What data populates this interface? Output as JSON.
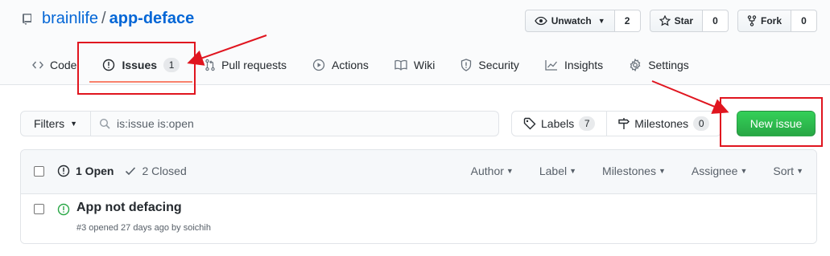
{
  "repo": {
    "owner": "brainlife",
    "separator": "/",
    "name": "app-deface"
  },
  "actions": {
    "watch": {
      "label": "Unwatch",
      "count": "2"
    },
    "star": {
      "label": "Star",
      "count": "0"
    },
    "fork": {
      "label": "Fork",
      "count": "0"
    }
  },
  "tabs": [
    {
      "label": "Code"
    },
    {
      "label": "Issues",
      "count": "1"
    },
    {
      "label": "Pull requests"
    },
    {
      "label": "Actions"
    },
    {
      "label": "Wiki"
    },
    {
      "label": "Security"
    },
    {
      "label": "Insights"
    },
    {
      "label": "Settings"
    }
  ],
  "subnav": {
    "filters_label": "Filters",
    "search_value": "is:issue is:open",
    "labels_label": "Labels",
    "labels_count": "7",
    "milestones_label": "Milestones",
    "milestones_count": "0",
    "new_issue_label": "New issue"
  },
  "issues_header": {
    "open_label": "1 Open",
    "closed_label": "2 Closed",
    "sorts": [
      "Author",
      "Label",
      "Milestones",
      "Assignee",
      "Sort"
    ]
  },
  "issues": [
    {
      "title": "App not defacing",
      "meta": "#3 opened 27 days ago by soichih"
    }
  ],
  "colors": {
    "accent": "#0366d6",
    "primary_button": "#2ea44f",
    "open_icon": "#28a745",
    "tab_underline": "#f9826c",
    "annotation": "#e0151f"
  }
}
